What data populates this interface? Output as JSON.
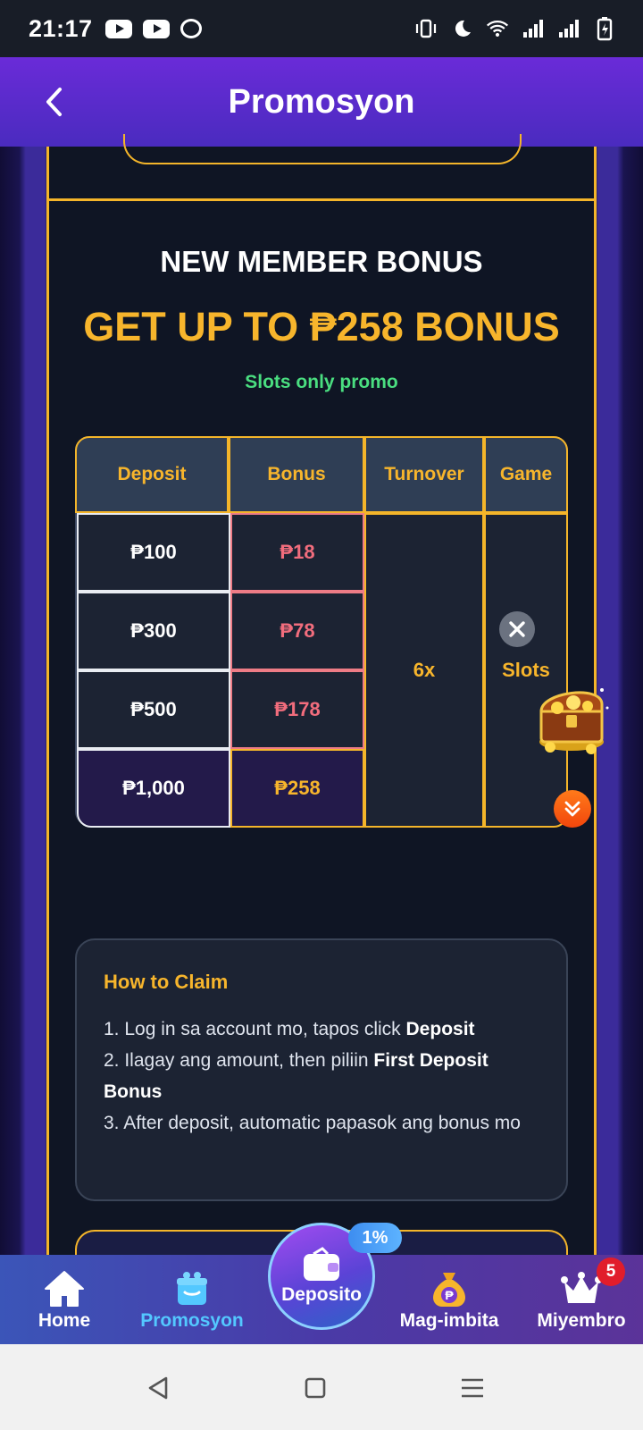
{
  "status_bar": {
    "time": "21:17",
    "left_icons": [
      "youtube-icon",
      "youtube-icon",
      "cast-icon"
    ],
    "right_icons": [
      "vibrate-icon",
      "moon-icon",
      "wifi-icon",
      "signal-icon",
      "signal-icon",
      "battery-charging-icon"
    ]
  },
  "header": {
    "title": "Promosyon"
  },
  "promo": {
    "heading": "NEW MEMBER BONUS",
    "headline": "GET UP TO ₱258 BONUS",
    "note": "Slots only promo"
  },
  "table": {
    "headers": [
      "Deposit",
      "Bonus",
      "Turnover",
      "Game"
    ],
    "rows": [
      {
        "deposit": "₱100",
        "bonus": "₱18"
      },
      {
        "deposit": "₱300",
        "bonus": "₱78"
      },
      {
        "deposit": "₱500",
        "bonus": "₱178"
      },
      {
        "deposit": "₱1,000",
        "bonus": "₱258"
      }
    ],
    "turnover": "6x",
    "game": "Slots"
  },
  "claim": {
    "title": "How to Claim",
    "step1_text": "1. Log in sa account mo, tapos click ",
    "step1_bold": "Deposit",
    "step2_text": "2. Ilagay ang amount, then piliin ",
    "step2_bold": "First Deposit Bonus",
    "step3_text": "3. After deposit, automatic papasok ang bonus mo"
  },
  "bottom_nav": {
    "home": "Home",
    "promos": "Promosyon",
    "deposit": "Deposito",
    "deposit_badge": "1%",
    "invite": "Mag-imbita",
    "member": "Miyembro",
    "member_badge": "5"
  },
  "colors": {
    "accent_gold": "#f7b52c",
    "header_purple": "#6a2bd8",
    "bonus_pink": "#f26d7d",
    "promo_green": "#4ade80",
    "active_blue": "#53c8ff"
  }
}
